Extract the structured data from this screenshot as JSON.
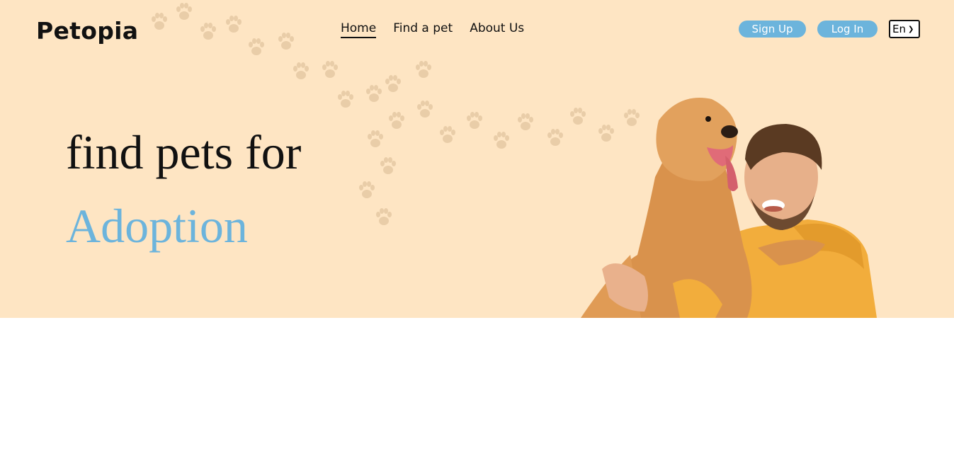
{
  "brand": {
    "name": "Petopia"
  },
  "nav": {
    "items": [
      {
        "label": "Home",
        "active": true
      },
      {
        "label": "Find a pet",
        "active": false
      },
      {
        "label": "About Us",
        "active": false
      }
    ]
  },
  "auth": {
    "signup_label": "Sign Up",
    "login_label": "Log In"
  },
  "language": {
    "selected": "En"
  },
  "hero": {
    "line1": "find pets for",
    "line2": "Adoption"
  },
  "colors": {
    "hero_bg": "#fee5c3",
    "accent": "#6cb4dc",
    "text": "#111111"
  },
  "icons": [
    "paw-print-icon",
    "chevron-down-icon"
  ]
}
